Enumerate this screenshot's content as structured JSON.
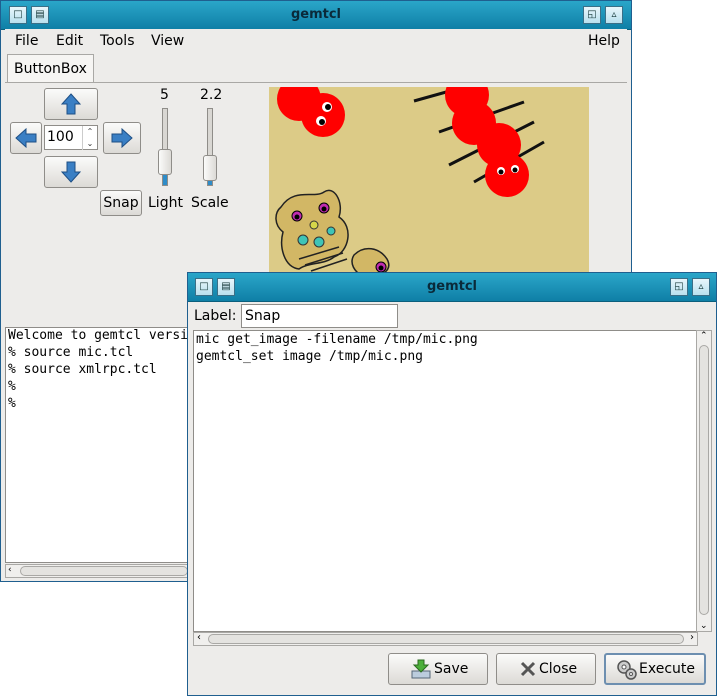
{
  "main_window": {
    "title": "gemtcl",
    "menu": {
      "file": "File",
      "edit": "Edit",
      "tools": "Tools",
      "view": "View",
      "help": "Help"
    },
    "tab": "ButtonBox",
    "spin_value": "100",
    "snap_label": "Snap",
    "light": {
      "label": "Light",
      "value": "5"
    },
    "scale": {
      "label": "Scale",
      "value": "2.2"
    },
    "console_lines": [
      "Welcome to gemtcl versi",
      "% source mic.tcl",
      "% source xmlrpc.tcl",
      "%",
      "%"
    ]
  },
  "dialog": {
    "title": "gemtcl",
    "label_caption": "Label:",
    "label_value": "Snap",
    "code_lines": [
      "mic get_image -filename /tmp/mic.png",
      "gemtcl_set image /tmp/mic.png"
    ],
    "save": "Save",
    "close": "Close",
    "execute": "Execute"
  },
  "colors": {
    "titlebar": "#1d93bb",
    "canvas_bg": "#dccb87",
    "creature_red": "#ff0000",
    "blob": "#d2b765",
    "accent_blue": "#2e8cc8"
  }
}
